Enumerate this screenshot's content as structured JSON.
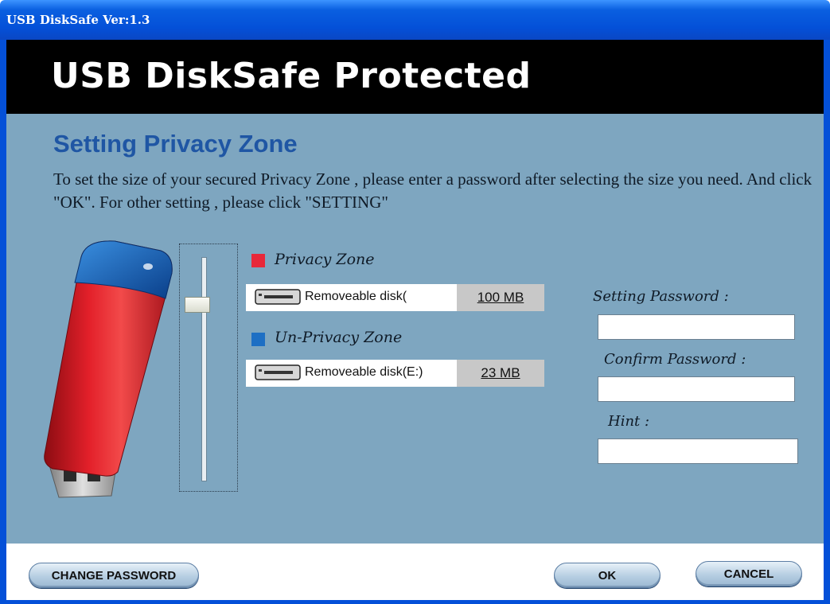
{
  "window": {
    "title": "USB DiskSafe Ver:1.3"
  },
  "header": {
    "title": "USB DiskSafe Protected"
  },
  "section": {
    "title": "Setting Privacy Zone",
    "description": "To set the size of your secured Privacy Zone , please enter a password after selecting the size you need. And click \"OK\". For other setting , please click \"SETTING\""
  },
  "zones": {
    "privacy": {
      "label": "Privacy Zone",
      "disk": "Removeable disk(",
      "size": "100 MB",
      "color": "#e8283a"
    },
    "unprivacy": {
      "label": "Un-Privacy Zone",
      "disk": "Removeable disk(E:)",
      "size": "23 MB",
      "color": "#1d6fc4"
    }
  },
  "form": {
    "setting_label": "Setting Password :",
    "confirm_label": "Confirm Password :",
    "hint_label": "Hint :",
    "setting_value": "",
    "confirm_value": "",
    "hint_value": ""
  },
  "buttons": {
    "change_password": "CHANGE PASSWORD",
    "ok": "OK",
    "cancel": "CANCEL"
  },
  "slider": {
    "value_fraction": 0.19
  }
}
